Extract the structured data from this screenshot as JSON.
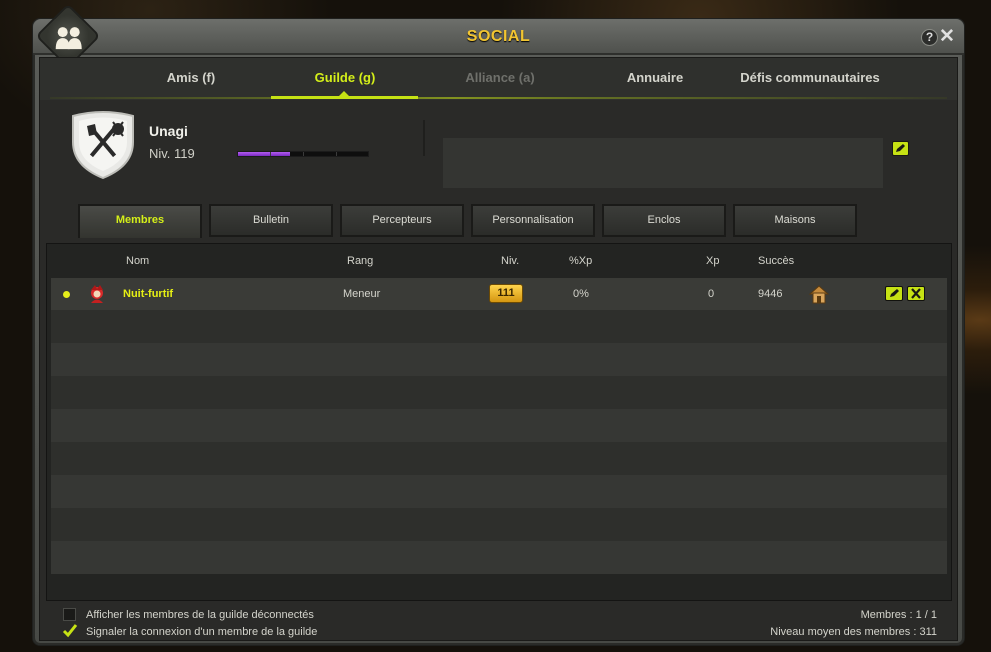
{
  "window": {
    "title": "SOCIAL",
    "help_label": "?",
    "close_label": "✕"
  },
  "main_tabs": [
    {
      "label": "Amis (f)",
      "state": "normal"
    },
    {
      "label": "Guilde (g)",
      "state": "active"
    },
    {
      "label": "Alliance (a)",
      "state": "disabled"
    },
    {
      "label": "Annuaire",
      "state": "normal"
    },
    {
      "label": "Défis communautaires",
      "state": "normal"
    }
  ],
  "guild": {
    "name": "Unagi",
    "level_text": "Niv. 119",
    "xp_progress": 0.4,
    "message": ""
  },
  "sub_tabs": [
    {
      "label": "Membres",
      "active": true
    },
    {
      "label": "Bulletin",
      "active": false
    },
    {
      "label": "Percepteurs",
      "active": false
    },
    {
      "label": "Personnalisation",
      "active": false
    },
    {
      "label": "Enclos",
      "active": false
    },
    {
      "label": "Maisons",
      "active": false
    }
  ],
  "members_table": {
    "columns": [
      "Nom",
      "Rang",
      "Niv.",
      "%Xp",
      "Xp",
      "Succès"
    ],
    "rows": [
      {
        "status": "online",
        "name": "Nuit-furtif",
        "rank": "Meneur",
        "level": "111",
        "xp_percent": "0%",
        "xp": "0",
        "success": "9446",
        "icons": [
          "house-icon",
          "edit-icon",
          "kick-icon"
        ]
      }
    ]
  },
  "footer": {
    "show_offline_label": "Afficher les membres de la guilde déconnectés",
    "show_offline_checked": false,
    "notify_login_label": "Signaler la connexion d'un membre de la guilde",
    "notify_login_checked": true,
    "members_count": "Membres : 1 / 1",
    "average_level": "Niveau moyen des membres : 311"
  },
  "colors": {
    "accent": "#c6e214",
    "title": "#f2c531",
    "xp_bar": "#9a45dc",
    "level_badge": "#f0b62a"
  }
}
